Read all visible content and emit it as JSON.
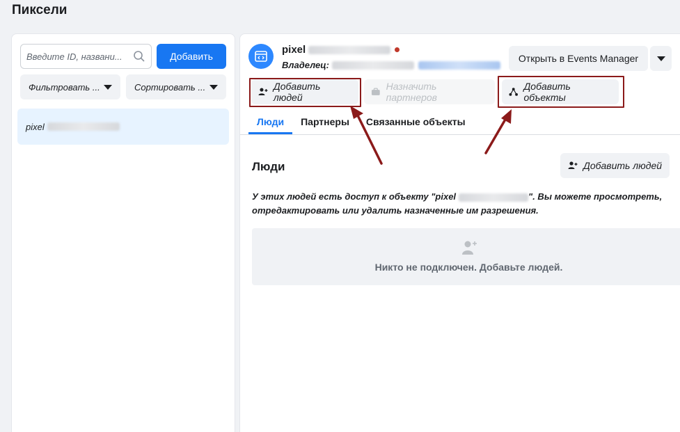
{
  "page": {
    "title": "Пиксели"
  },
  "left": {
    "search": {
      "placeholder": "Введите ID, названи..."
    },
    "add_label": "Добавить",
    "filter_label": "Фильтровать ...",
    "sort_label": "Сортировать ...",
    "items": [
      {
        "label": "pixel"
      }
    ]
  },
  "right": {
    "pixel_name": "pixel",
    "owner_label": "Владелец:",
    "open_events_manager": "Открыть в Events Manager",
    "actions": {
      "add_people": "Добавить людей",
      "assign_partners": "Назначить партнеров",
      "add_assets": "Добавить объекты"
    },
    "tabs": [
      "Люди",
      "Партнеры",
      "Связанные объекты"
    ],
    "people_section": {
      "title": "Люди",
      "add_people": "Добавить людей",
      "info_part1": "У этих людей есть доступ к объекту \"pixel",
      "info_part2": "\". Вы можете просмотреть, отредактировать или удалить назначенные им разрешения.",
      "empty_text": "Никто не подключен. Добавьте людей."
    }
  },
  "colors": {
    "accent": "#1877f2",
    "highlight": "#8b1a1a",
    "status_dot": "#c0392b"
  }
}
